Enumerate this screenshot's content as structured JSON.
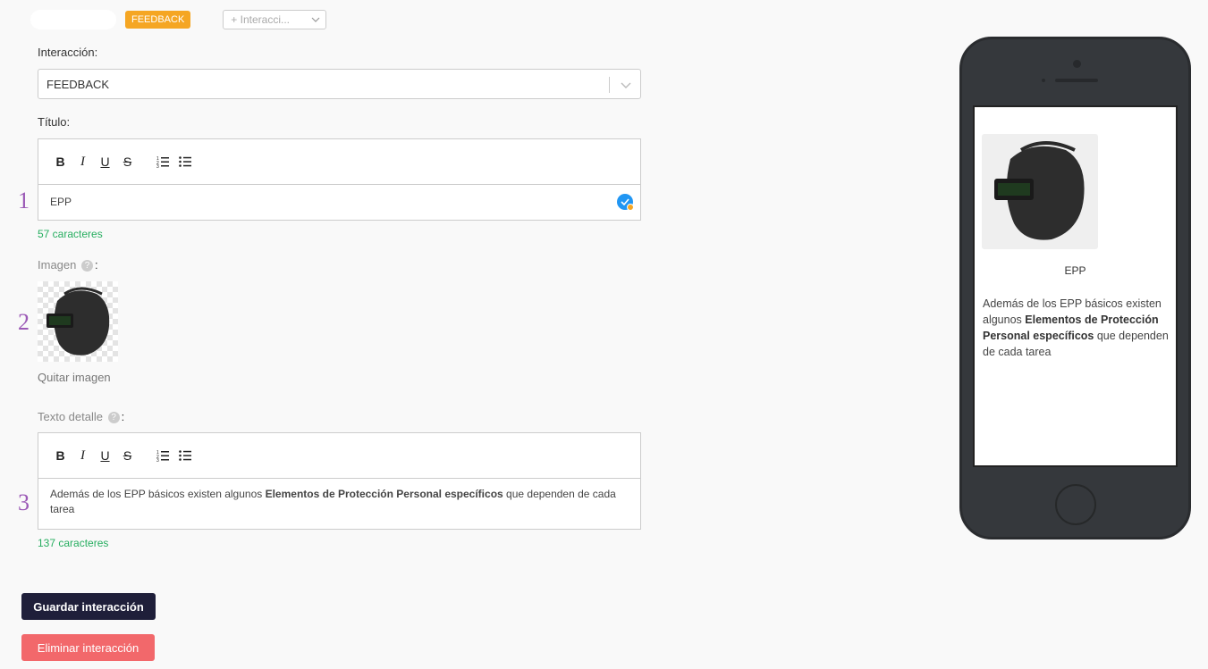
{
  "header": {
    "type_tag": "FEEDBACK",
    "add_dropdown": "+ Interacci..."
  },
  "form": {
    "interaction_label": "Interacción",
    "interaction_value": "FEEDBACK",
    "title_label": "Título",
    "title_value": "EPP",
    "title_counter": "57 caracteres",
    "image_label": "Imagen",
    "remove_image": "Quitar imagen",
    "detail_label": "Texto detalle",
    "detail_text_before": "Además de los EPP básicos existen algunos ",
    "detail_text_bold": "Elementos de Protección Personal específicos",
    "detail_text_after": " que dependen de cada tarea",
    "detail_counter": "137 caracteres",
    "step_numbers": [
      "1",
      "2",
      "3"
    ]
  },
  "toolbar": {
    "bold": "B",
    "italic": "I",
    "underline": "U",
    "strike": "S"
  },
  "actions": {
    "save": "Guardar interacción",
    "delete": "Eliminar interacción"
  },
  "preview": {
    "title": "EPP",
    "text_before": "Además de los EPP básicos existen algunos ",
    "text_bold": "Elementos de Protección Personal específicos",
    "text_after": " que dependen de cada tarea"
  },
  "colors": {
    "tag": "#f5a623",
    "counter": "#27ae60",
    "step": "#9b59b6",
    "save": "#1f1f3a",
    "delete": "#f2686b"
  }
}
